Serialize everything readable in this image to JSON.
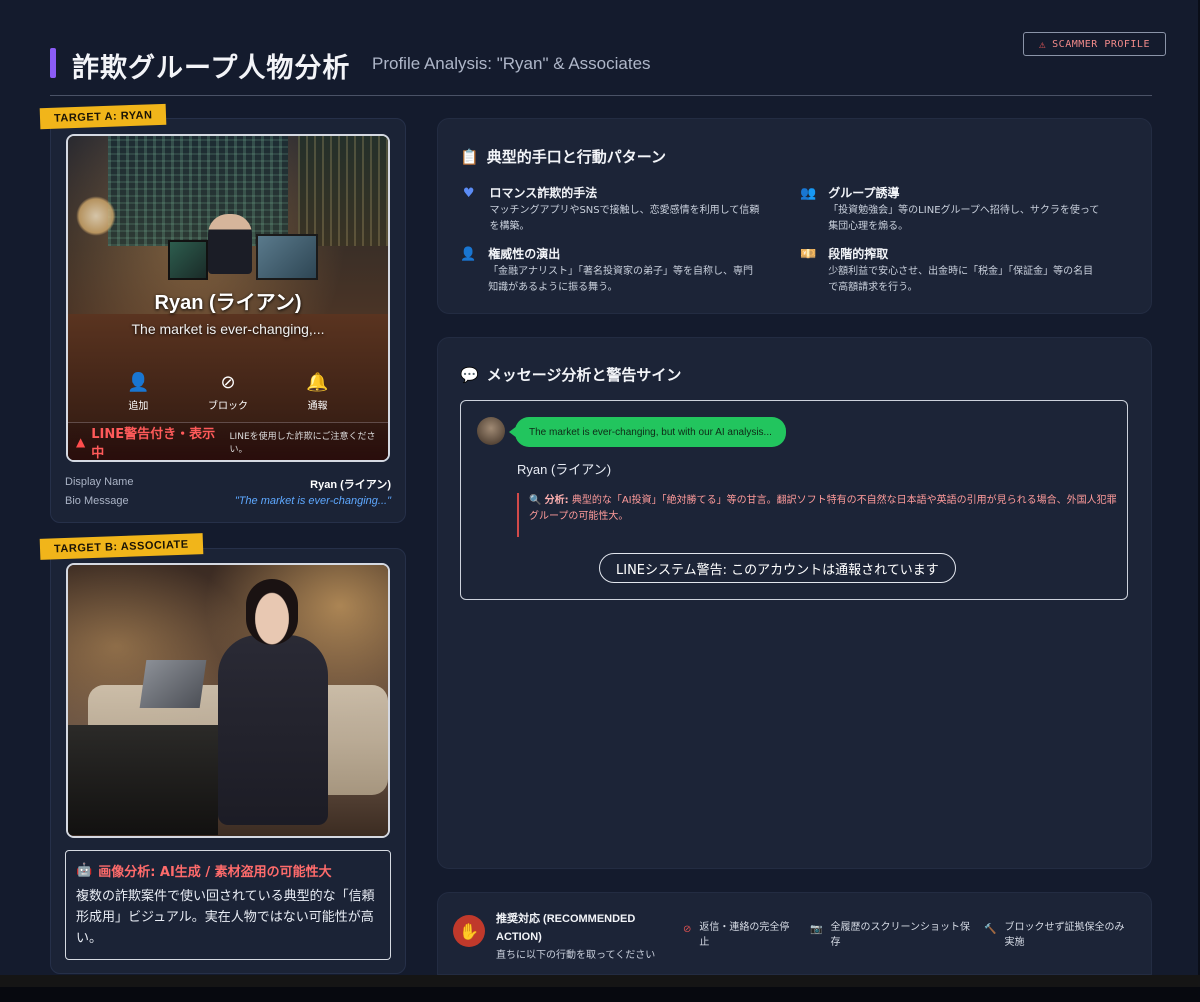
{
  "header": {
    "title_jp": "詐欺グループ人物分析",
    "title_en": "Profile Analysis: \"Ryan\" & Associates",
    "badge": "SCAMMER PROFILE"
  },
  "target_a": {
    "tag": "TARGET A: RYAN",
    "profile_name": "Ryan (ライアン)",
    "profile_bio": "The market is ever-changing,...",
    "actions": [
      "追加",
      "ブロック",
      "通報"
    ],
    "warning_text": "LINE警告付き・表示中",
    "warning_sub": "LINEを使用した詐欺にご注意ください。",
    "display_name_label": "Display Name",
    "display_name_value": "Ryan (ライアン)",
    "bio_label": "Bio Message",
    "bio_value": "\"The market is ever-changing...\""
  },
  "target_b": {
    "tag": "TARGET B: ASSOCIATE",
    "ai_title": "画像分析: AI生成 / 素材盗用の可能性大",
    "ai_text": "複数の詐欺案件で使い回されている典型的な「信頼形成用」ビジュアル。実在人物ではない可能性が高い。"
  },
  "tactics_panel": {
    "title": "典型的手口と行動パターン",
    "items": [
      {
        "icon": "heart-icon",
        "color": "#5b8cf5",
        "title": "ロマンス詐欺的手法",
        "desc": "マッチングアプリやSNSで接触し、恋愛感情を利用して信頼を構築。"
      },
      {
        "icon": "group-icon",
        "color": "#f2b01e",
        "title": "グループ誘導",
        "desc": "「投資勉強会」等のLINEグループへ招待し、サクラを使って集団心理を煽る。"
      },
      {
        "icon": "person-tie-icon",
        "color": "#a78bfa",
        "title": "権威性の演出",
        "desc": "「金融アナリスト」「著名投資家の弟子」等を自称し、専門知識があるように振る舞う。"
      },
      {
        "icon": "money-icon",
        "color": "#e05252",
        "title": "段階的搾取",
        "desc": "少額利益で安心させ、出金時に「税金」「保証金」等の名目で高額請求を行う。"
      }
    ]
  },
  "message_panel": {
    "title": "メッセージ分析と警告サイン",
    "bubble": "The market is ever-changing, but with our AI analysis...",
    "sender": "Ryan (ライアン)",
    "analysis_label": "分析:",
    "analysis_text": "典型的な「AI投資」「絶対勝てる」等の甘言。翻訳ソフト特有の不自然な日本語や英語の引用が見られる場合、外国人犯罪グループの可能性大。",
    "system_warning": "LINEシステム警告: このアカウントは通報されています"
  },
  "action_panel": {
    "title": "推奨対応 (RECOMMENDED ACTION)",
    "subtitle": "直ちに以下の行動を取ってください",
    "items": [
      {
        "icon": "ban-icon",
        "color": "#e05252",
        "text": "返信・連絡の完全停止"
      },
      {
        "icon": "camera-icon",
        "color": "#5b8cf5",
        "text": "全履歴のスクリーンショット保存"
      },
      {
        "icon": "gavel-icon",
        "color": "#f2b01e",
        "text": "ブロックせず証拠保全のみ実施"
      }
    ]
  }
}
